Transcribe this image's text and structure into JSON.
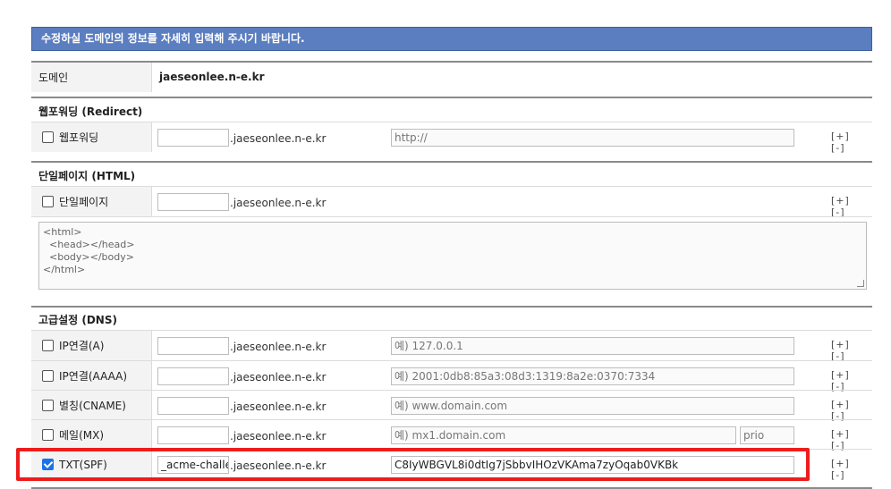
{
  "banner_text": "수정하실 도메인의 정보를 자세히 입력해 주시기 바랍니다.",
  "domain_row": {
    "label": "도메인",
    "value": "jaeseonlee.n-e.kr"
  },
  "suffix": ".jaeseonlee.n-e.kr",
  "plus": "[+]",
  "minus": "[-]",
  "sections": {
    "redirect": "웹포워딩 (Redirect)",
    "html": "단일페이지 (HTML)",
    "dns": "고급설정 (DNS)"
  },
  "redirect_row": {
    "label": "웹포워딩",
    "placeholder": "http://",
    "checked": false
  },
  "html_row": {
    "label": "단일페이지",
    "checked": false
  },
  "html_content": "<html>\n  <head></head>\n  <body></body>\n</html>",
  "dns_rows": [
    {
      "label": "IP연결(A)",
      "placeholder": "예) 127.0.0.1",
      "checked": false
    },
    {
      "label": "IP연결(AAAA)",
      "placeholder": "예) 2001:0db8:85a3:08d3:1319:8a2e:0370:7334",
      "checked": false
    },
    {
      "label": "별칭(CNAME)",
      "placeholder": "예) www.domain.com",
      "checked": false
    },
    {
      "label": "메일(MX)",
      "placeholder": "예) mx1.domain.com",
      "prio_placeholder": "prio",
      "checked": false
    },
    {
      "label": "TXT(SPF)",
      "sub_value": "_acme-challenge",
      "value": "C8IyWBGVL8i0dtIg7jSbbvIHOzVKAma7zyOqab0VKBk",
      "checked": true
    }
  ],
  "colors": {
    "banner": "#5b7ec0",
    "highlight": "#ee1c1c",
    "checkbox_checked": "#1a73e8"
  }
}
